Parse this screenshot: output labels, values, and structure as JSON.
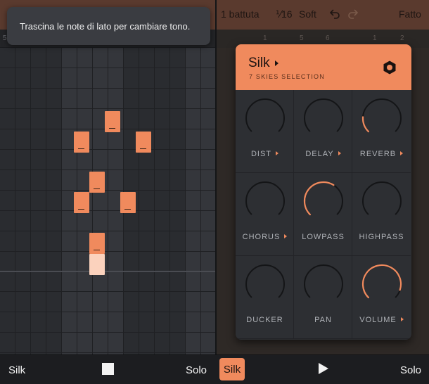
{
  "toast": {
    "text": "Trascina le note di lato per cambiare tono."
  },
  "top_bar": {
    "length": "1 battuta",
    "grid": "⅟16",
    "velocity": "Soft",
    "undo_icon": "undo-icon",
    "redo_icon": "redo-icon",
    "done": "Fatto"
  },
  "ruler": {
    "left": [
      "5"
    ],
    "right": [
      "1",
      "5",
      "6",
      "1",
      "2"
    ]
  },
  "instrument": {
    "name": "Silk",
    "pack": "7 SKIES SELECTION",
    "settings_icon": "hexagon-nut-icon",
    "accent": "#f08a5d",
    "knobs": [
      {
        "label": "DIST",
        "value": 0.0,
        "has_menu": true
      },
      {
        "label": "DELAY",
        "value": 0.0,
        "has_menu": true
      },
      {
        "label": "REVERB",
        "value": 0.18,
        "has_menu": true
      },
      {
        "label": "CHORUS",
        "value": 0.0,
        "has_menu": true
      },
      {
        "label": "LOWPASS",
        "value": 0.62,
        "has_menu": false
      },
      {
        "label": "HIGHPASS",
        "value": 0.0,
        "has_menu": false
      },
      {
        "label": "DUCKER",
        "value": 0.0,
        "has_menu": false
      },
      {
        "label": "PAN",
        "value": 0.0,
        "has_menu": false
      },
      {
        "label": "VOLUME",
        "value": 0.9,
        "has_menu": true
      }
    ]
  },
  "bottom_bar": {
    "left_instrument": "Silk",
    "left_solo": "Solo",
    "right_instrument": "Silk",
    "right_solo": "Solo",
    "stop_icon": "stop-icon",
    "play_icon": "play-icon"
  }
}
